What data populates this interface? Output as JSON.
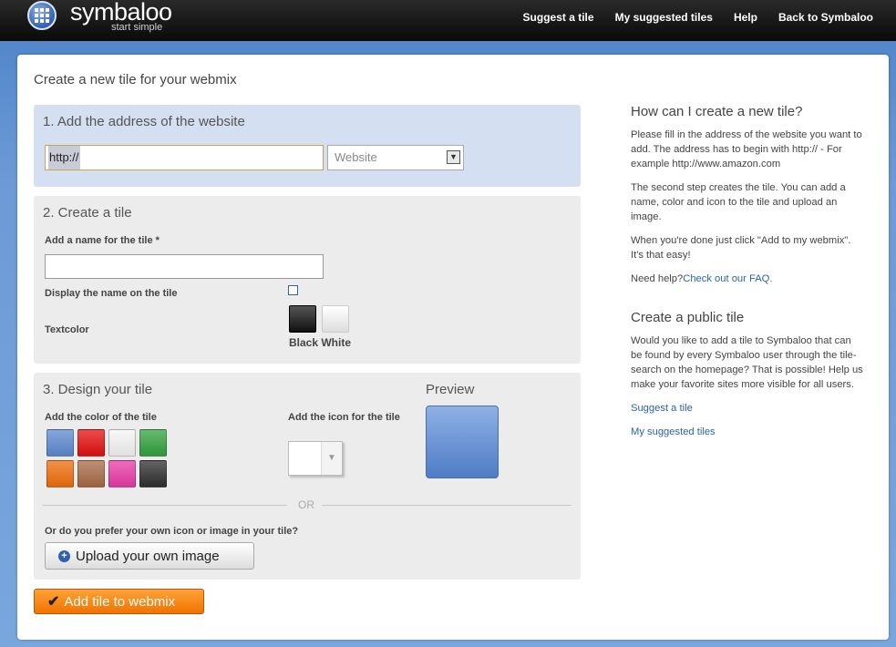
{
  "header": {
    "logo_text": "symbaloo",
    "logo_tagline": "start simple",
    "nav": [
      "Suggest a tile",
      "My suggested tiles",
      "Help",
      "Back to Symbaloo"
    ]
  },
  "page": {
    "title": "Create a new tile for your webmix"
  },
  "step1": {
    "heading": "1. Add the address of the website",
    "url_value": "http://",
    "type_select": "Website"
  },
  "step2": {
    "heading": "2. Create a tile",
    "name_label": "Add a name for the tile *",
    "name_value": "",
    "display_name_label": "Display the name on the tile",
    "textcolor_label": "Textcolor",
    "textcolor_options": "Black White"
  },
  "step3": {
    "heading": "3. Design your tile",
    "color_label": "Add the color of the tile",
    "icon_label": "Add the icon for the tile",
    "preview_label": "Preview",
    "colors": [
      "#5d8ad0",
      "#e40f0f",
      "#f4f4f4",
      "#34a23f",
      "#ef6d0c",
      "#a86a45",
      "#e83aa6",
      "#2f2f2f"
    ],
    "or_text": "OR",
    "own_image_label": "Or do you prefer your own icon or image in your tile?",
    "upload_button": "Upload your own image"
  },
  "submit_button": "Add tile to webmix",
  "help": {
    "heading": "How can I create a new tile?",
    "p1": "Please fill in the address of the website you want to add. The address has to begin with http:// - For example http://www.amazon.com",
    "p2": "The second step creates the tile. You can add a name, color and icon to the tile and upload an image.",
    "p3": "When you're done just click \"Add to my webmix\". It's that easy!",
    "need_help": "Need help?",
    "faq_link": "Check out our FAQ."
  },
  "public": {
    "heading": "Create a public tile",
    "text": "Would you like to add a tile to Symbaloo that can be found by every Symbaloo user through the tile-search on the homepage? That is possible! Help us make your favorite sites more visible for all users.",
    "link1": "Suggest a tile",
    "link2": "My suggested tiles"
  }
}
